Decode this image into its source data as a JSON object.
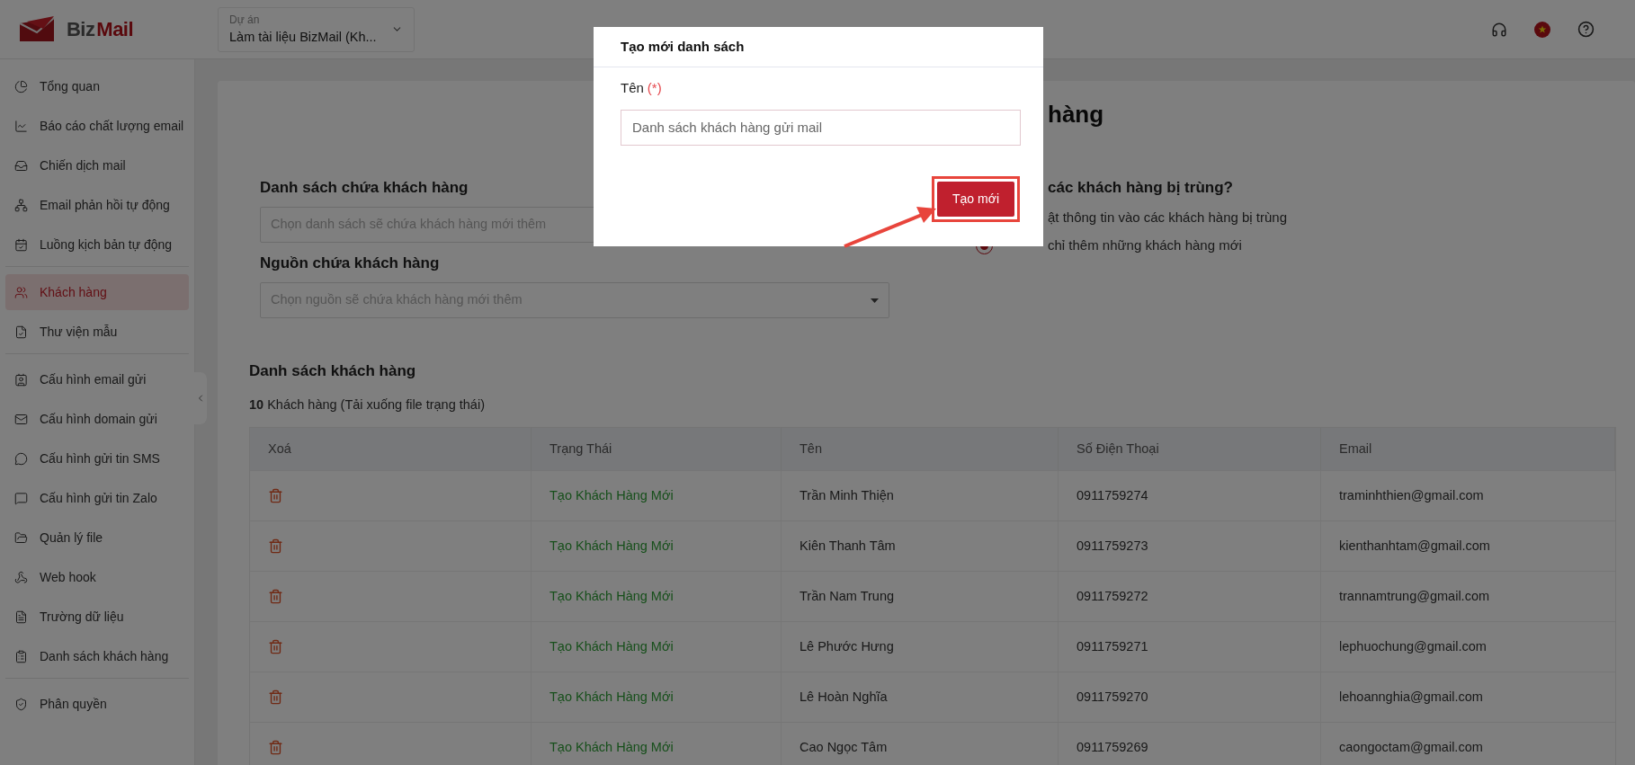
{
  "header": {
    "logo_text": [
      "Biz",
      "Mail"
    ],
    "project": {
      "label": "Dự án",
      "value": "Làm tài liệu BizMail (Kh..."
    }
  },
  "sidebar": {
    "sections": [
      [
        {
          "label": "Tổng quan",
          "selected": false
        },
        {
          "label": "Báo cáo chất lượng email",
          "selected": false
        },
        {
          "label": "Chiến dịch mail",
          "selected": false
        },
        {
          "label": "Email phản hồi tự động",
          "selected": false
        },
        {
          "label": "Luồng kịch bản tự động",
          "selected": false
        }
      ],
      [
        {
          "label": "Khách hàng",
          "selected": true
        },
        {
          "label": "Thư viện mẫu",
          "selected": false
        }
      ],
      [
        {
          "label": "Cấu hình email gửi",
          "selected": false
        },
        {
          "label": "Cấu hình domain gửi",
          "selected": false
        },
        {
          "label": "Cấu hình gửi tin SMS",
          "selected": false
        },
        {
          "label": "Cấu hình gửi tin Zalo",
          "selected": false
        },
        {
          "label": "Quản lý file",
          "selected": false
        },
        {
          "label": "Web hook",
          "selected": false
        },
        {
          "label": "Trường dữ liệu",
          "selected": false
        },
        {
          "label": "Danh sách khách hàng",
          "selected": false
        }
      ],
      [
        {
          "label": "Phân quyền",
          "selected": false
        }
      ]
    ]
  },
  "page": {
    "title": "hàng",
    "list_field": {
      "label": "Danh sách chứa khách hàng",
      "placeholder": "Chọn danh sách sẽ chứa khách hàng mới thêm"
    },
    "source_field": {
      "label": "Nguồn chứa khách hàng",
      "placeholder": "Chọn nguồn sẽ chứa khách hàng mới thêm"
    },
    "duplicate": {
      "title": "các khách hàng bị trùng?",
      "options": [
        {
          "kind": "text",
          "label": "ật thông tin vào các khách hàng bị trùng"
        },
        {
          "kind": "radio",
          "label": "chỉ thêm những khách hàng mới",
          "selected": true
        }
      ]
    },
    "customers": {
      "title": "Danh sách khách hàng",
      "count": "10",
      "count_text": "Khách hàng (Tải xuống file trạng thái)",
      "columns": [
        "Xoá",
        "Trạng Thái",
        "Tên",
        "Số Điện Thoại",
        "Email"
      ],
      "rows": [
        {
          "status": "Tạo Khách Hàng Mới",
          "name": "Trần Minh Thiện",
          "phone": "0911759274",
          "email": "traminhthien@gmail.com"
        },
        {
          "status": "Tạo Khách Hàng Mới",
          "name": "Kiên Thanh Tâm",
          "phone": "0911759273",
          "email": "kienthanhtam@gmail.com"
        },
        {
          "status": "Tạo Khách Hàng Mới",
          "name": "Trần Nam Trung",
          "phone": "0911759272",
          "email": "trannamtrung@gmail.com"
        },
        {
          "status": "Tạo Khách Hàng Mới",
          "name": "Lê Phước Hưng",
          "phone": "0911759271",
          "email": "lephuochung@gmail.com"
        },
        {
          "status": "Tạo Khách Hàng Mới",
          "name": "Lê Hoàn Nghĩa",
          "phone": "0911759270",
          "email": "lehoannghia@gmail.com"
        },
        {
          "status": "Tạo Khách Hàng Mới",
          "name": "Cao Ngọc Tâm",
          "phone": "0911759269",
          "email": "caongoctam@gmail.com"
        }
      ]
    }
  },
  "modal": {
    "title": "Tạo mới danh sách",
    "field_label": "Tên",
    "required_mark": "(*)",
    "value": "Danh sách khách hàng gửi mail",
    "submit": "Tạo mới"
  }
}
